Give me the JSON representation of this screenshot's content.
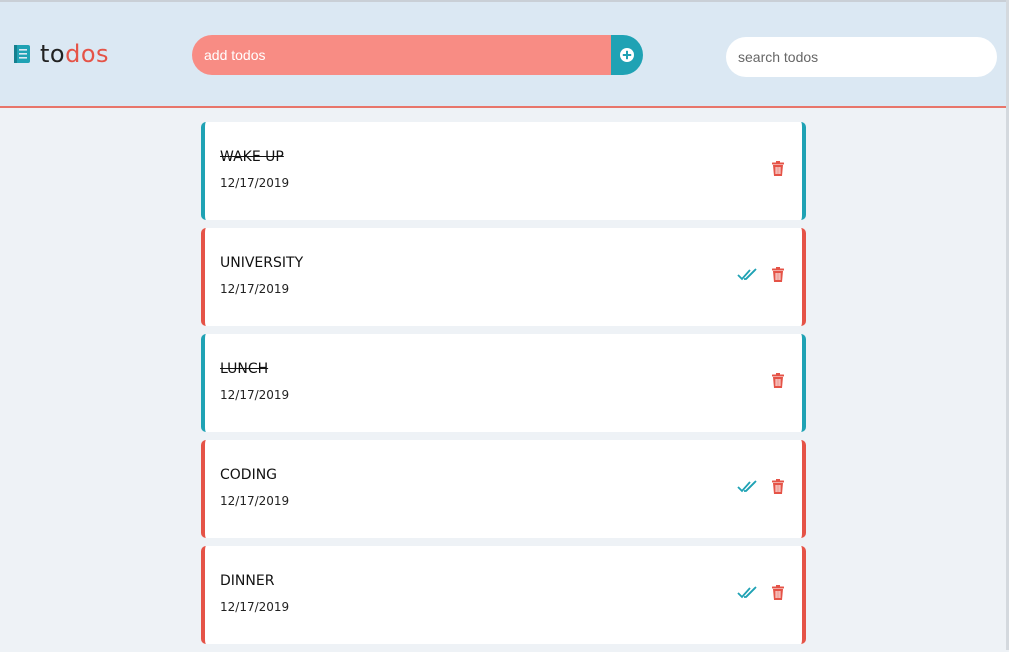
{
  "brand": {
    "name_part1": "to",
    "name_part2": "dos",
    "icon": "book-icon",
    "color_part1": "#222222",
    "color_part2": "#e55347",
    "icon_color": "#1fa2b4"
  },
  "add": {
    "placeholder": "add todos",
    "button_icon": "plus-circle-icon",
    "input_color": "#f88c84",
    "button_color": "#1fa2b4"
  },
  "search": {
    "placeholder": "search todos"
  },
  "colors": {
    "done_accent": "#1fa2b4",
    "pending_accent": "#e55347",
    "check_icon": "#1fa2b4",
    "trash_icon": "#e55347"
  },
  "todos": [
    {
      "title": "WAKE UP",
      "date": "12/17/2019",
      "completed": true
    },
    {
      "title": "UNIVERSITY",
      "date": "12/17/2019",
      "completed": false
    },
    {
      "title": "LUNCH",
      "date": "12/17/2019",
      "completed": true
    },
    {
      "title": "CODING",
      "date": "12/17/2019",
      "completed": false
    },
    {
      "title": "DINNER",
      "date": "12/17/2019",
      "completed": false
    }
  ]
}
